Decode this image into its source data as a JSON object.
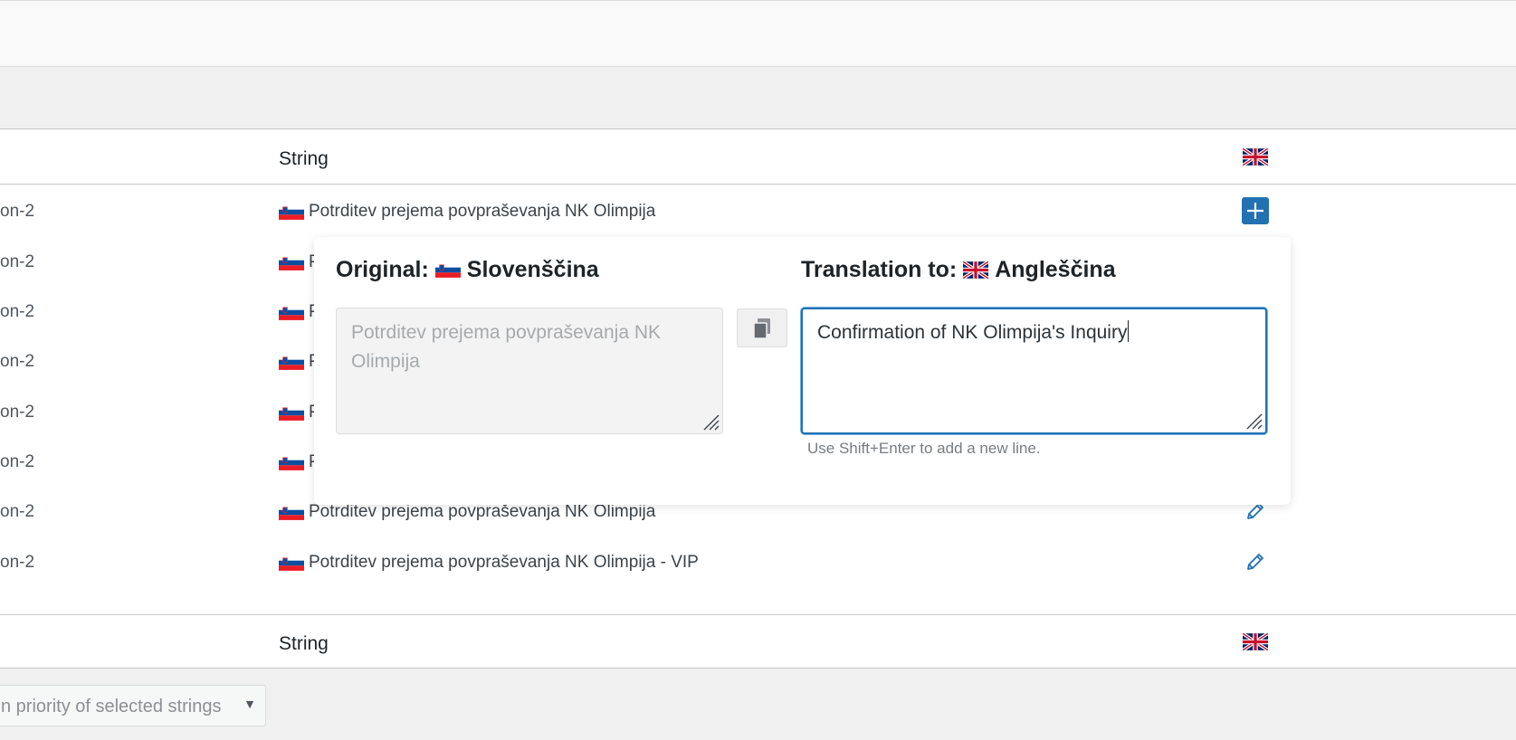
{
  "table": {
    "header": {
      "column_string": "String",
      "language_flag": "uk-flag-icon"
    },
    "footer": {
      "column_string": "String",
      "language_flag": "uk-flag-icon"
    },
    "rows": [
      {
        "context": "on-2",
        "string": "Potrditev prejema povpraševanja NK Olimpija",
        "action": "add-translation"
      },
      {
        "context": "on-2",
        "string": "P",
        "action": "hidden"
      },
      {
        "context": "on-2",
        "string": "P",
        "action": "hidden"
      },
      {
        "context": "on-2",
        "string": "P",
        "action": "hidden"
      },
      {
        "context": "on-2",
        "string": "P",
        "action": "hidden"
      },
      {
        "context": "on-2",
        "string": "P",
        "action": "hidden"
      },
      {
        "context": "on-2",
        "string": "Potrditev prejema povpraševanja NK Olimpija",
        "action": "edit"
      },
      {
        "context": "on-2",
        "string": "Potrditev prejema povpraševanja NK Olimpija - VIP",
        "action": "edit"
      }
    ]
  },
  "popup": {
    "original_label": "Original:",
    "original_language": "Slovenščina",
    "original_text": "Potrditev prejema povpraševanja NK Olimpija",
    "translation_label": "Translation to:",
    "translation_language": "Angleščina",
    "translation_text": "Confirmation of NK Olimpija's Inquiry",
    "hint": "Use Shift+Enter to add a new line."
  },
  "bulk_action": {
    "text": "n priority of selected strings",
    "arrow": "▼"
  },
  "colors": {
    "accent": "#2271b1",
    "border": "#c3c4c7",
    "background": "#f0f0f1"
  }
}
